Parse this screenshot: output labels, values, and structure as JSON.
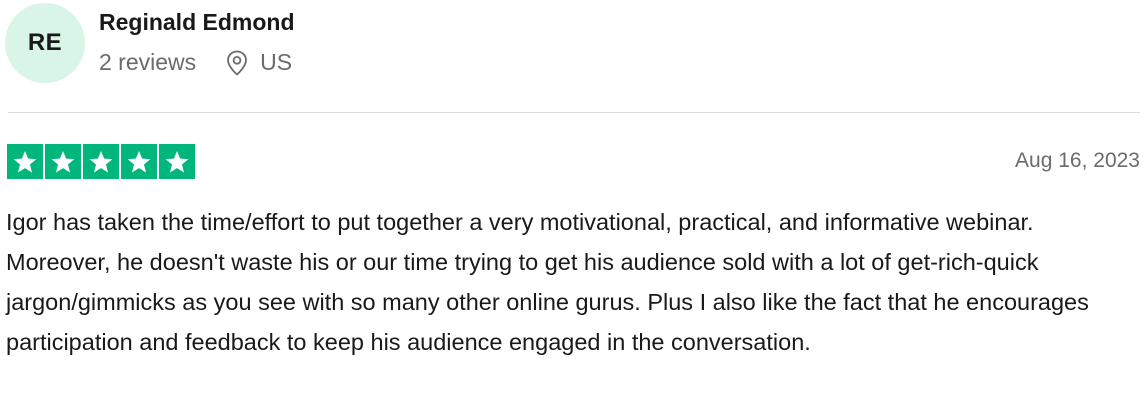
{
  "reviewer": {
    "initials": "RE",
    "name": "Reginald Edmond",
    "reviews_count": "2 reviews",
    "location": "US",
    "location_icon": "map-pin-icon"
  },
  "review": {
    "rating": 5,
    "rating_max": 5,
    "star_color": "#00b67a",
    "date": "Aug 16, 2023",
    "body": "Igor has taken the time/effort to put together a very motivational, practical, and informative webinar. Moreover, he doesn't waste his or our time trying to get his audience sold with a lot of get-rich-quick jargon/gimmicks as you see with so many other online gurus. Plus I also like the fact that he encourages participation and feedback to keep his audience engaged in the conversation."
  }
}
